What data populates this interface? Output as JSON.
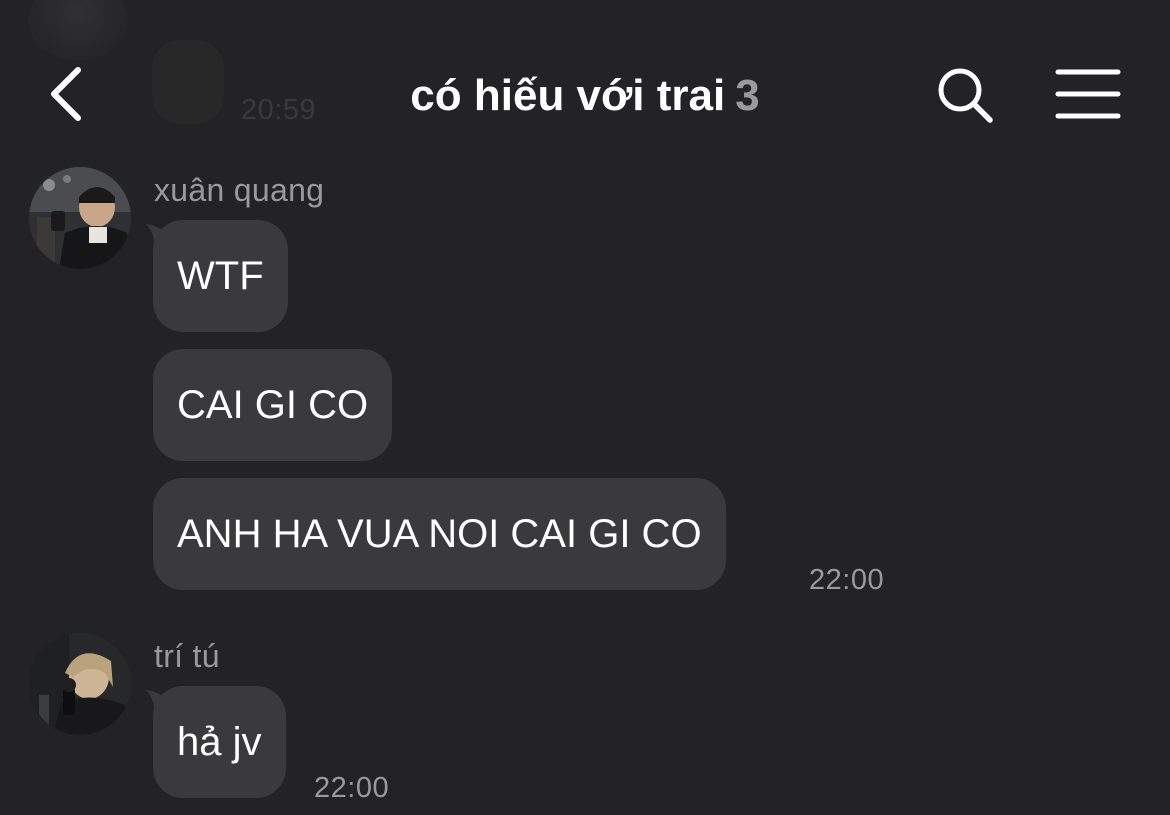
{
  "header": {
    "title": "có hiếu với trai",
    "member_count": "3",
    "back_icon": "chevron-left-icon",
    "search_icon": "search-icon",
    "menu_icon": "hamburger-menu-icon"
  },
  "previous": {
    "timestamp": "20:59"
  },
  "messages": [
    {
      "sender": "xuân quang",
      "bubbles": [
        "WTF",
        "CAI GI CO",
        "ANH HA VUA NOI CAI GI CO"
      ],
      "timestamp": "22:00"
    },
    {
      "sender": "trí tú",
      "bubbles": [
        "hả jv"
      ],
      "timestamp": "22:00"
    }
  ],
  "colors": {
    "background": "#232325",
    "bubble": "#3a3a3c",
    "text": "#ffffff",
    "muted": "#9a9a9e"
  }
}
